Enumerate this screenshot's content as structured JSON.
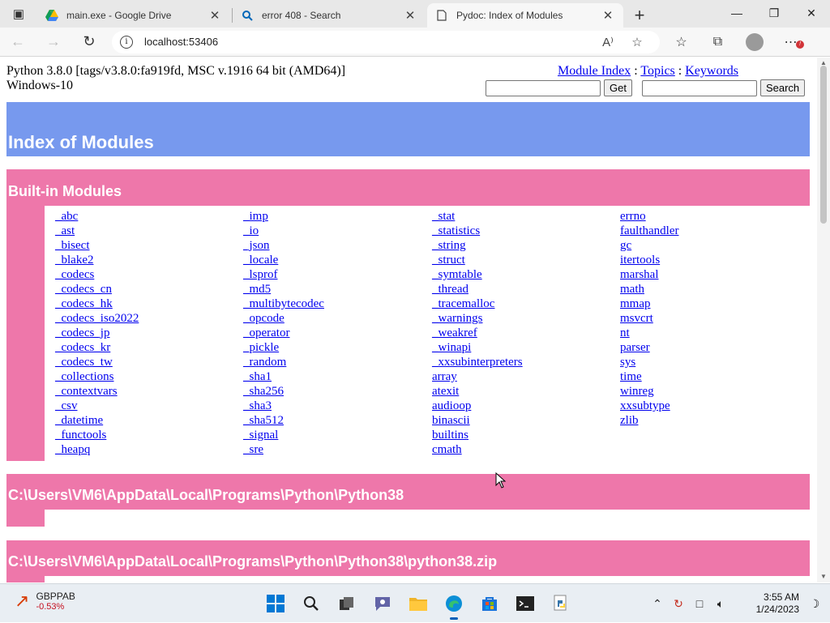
{
  "browser": {
    "tabs": [
      {
        "title": "main.exe - Google Drive",
        "icon": "google-drive-icon"
      },
      {
        "title": "error 408 - Search",
        "icon": "search-icon"
      },
      {
        "title": "Pydoc: Index of Modules",
        "icon": "page-icon"
      }
    ],
    "address": "localhost:53406"
  },
  "page": {
    "version_line1": "Python 3.8.0 [tags/v3.8.0:fa919fd, MSC v.1916 64 bit (AMD64)]",
    "version_line2": "Windows-10",
    "nav": {
      "module_index": "Module Index",
      "sep": " : ",
      "topics": "Topics",
      "keywords": "Keywords"
    },
    "get_button": "Get",
    "search_button": "Search",
    "index_title": "Index of Modules",
    "builtin_heading": "Built-in Modules",
    "modules": [
      [
        "_abc",
        "_ast",
        "_bisect",
        "_blake2",
        "_codecs",
        "_codecs_cn",
        "_codecs_hk",
        "_codecs_iso2022",
        "_codecs_jp",
        "_codecs_kr",
        "_codecs_tw",
        "_collections",
        "_contextvars",
        "_csv",
        "_datetime",
        "_functools",
        "_heapq"
      ],
      [
        "_imp",
        "_io",
        "_json",
        "_locale",
        "_lsprof",
        "_md5",
        "_multibytecodec",
        "_opcode",
        "_operator",
        "_pickle",
        "_random",
        "_sha1",
        "_sha256",
        "_sha3",
        "_sha512",
        "_signal",
        "_sre"
      ],
      [
        "_stat",
        "_statistics",
        "_string",
        "_struct",
        "_symtable",
        "_thread",
        "_tracemalloc",
        "_warnings",
        "_weakref",
        "_winapi",
        "_xxsubinterpreters",
        "array",
        "atexit",
        "audioop",
        "binascii",
        "builtins",
        "cmath"
      ],
      [
        "errno",
        "faulthandler",
        "gc",
        "itertools",
        "marshal",
        "math",
        "mmap",
        "msvcrt",
        "nt",
        "parser",
        "sys",
        "time",
        "winreg",
        "xxsubtype",
        "zlib"
      ]
    ],
    "path_heading1": "C:\\Users\\VM6\\AppData\\Local\\Programs\\Python\\Python38",
    "path_heading2": "C:\\Users\\VM6\\AppData\\Local\\Programs\\Python\\Python38\\python38.zip"
  },
  "taskbar": {
    "widget_symbol": "GBPPAB",
    "widget_change": "-0.53%",
    "time": "3:55 AM",
    "date": "1/24/2023"
  },
  "colors": {
    "index_banner": "#7799ee",
    "section_banner": "#ee77aa",
    "link": "#0000ee"
  }
}
